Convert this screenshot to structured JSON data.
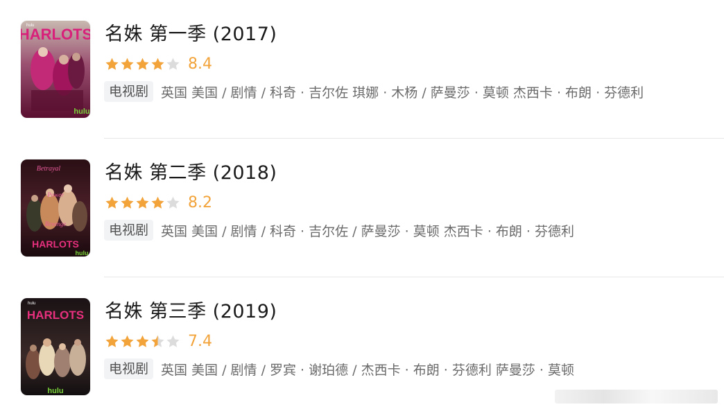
{
  "items": [
    {
      "title": "名姝 第一季 (2017)",
      "stars_filled": 4,
      "score": "8.4",
      "type_tag": "电视剧",
      "meta": "英国 美国 / 剧情 / 科奇 · 吉尔佐 琪娜 · 木杨 / 萨曼莎 · 莫顿 杰西卡 · 布朗 · 芬德利",
      "poster_text": "HARLOTS",
      "poster_brand": "hulu"
    },
    {
      "title": "名姝 第二季 (2018)",
      "stars_filled": 4,
      "score": "8.2",
      "type_tag": "电视剧",
      "meta": "英国 美国 / 剧情 / 科奇 · 吉尔佐 / 萨曼莎 · 莫顿 杰西卡 · 布朗 · 芬德利",
      "poster_text": "HARLOTS",
      "poster_brand": "hulu",
      "poster_words": [
        "Betrayal",
        "Power",
        "Revenge"
      ]
    },
    {
      "title": "名姝 第三季 (2019)",
      "stars_filled": 3.5,
      "score": "7.4",
      "type_tag": "电视剧",
      "meta": "英国 美国 / 剧情 / 罗宾 · 谢珀德 / 杰西卡 · 布朗 · 芬德利 萨曼莎 · 莫顿",
      "poster_text": "HARLOTS",
      "poster_brand": "hulu"
    }
  ],
  "colors": {
    "star": "#f2a33a",
    "star_empty": "#dcdcdc",
    "poster1": "#8a1a4a",
    "poster2": "#3d1a22",
    "poster3": "#1a1416"
  }
}
